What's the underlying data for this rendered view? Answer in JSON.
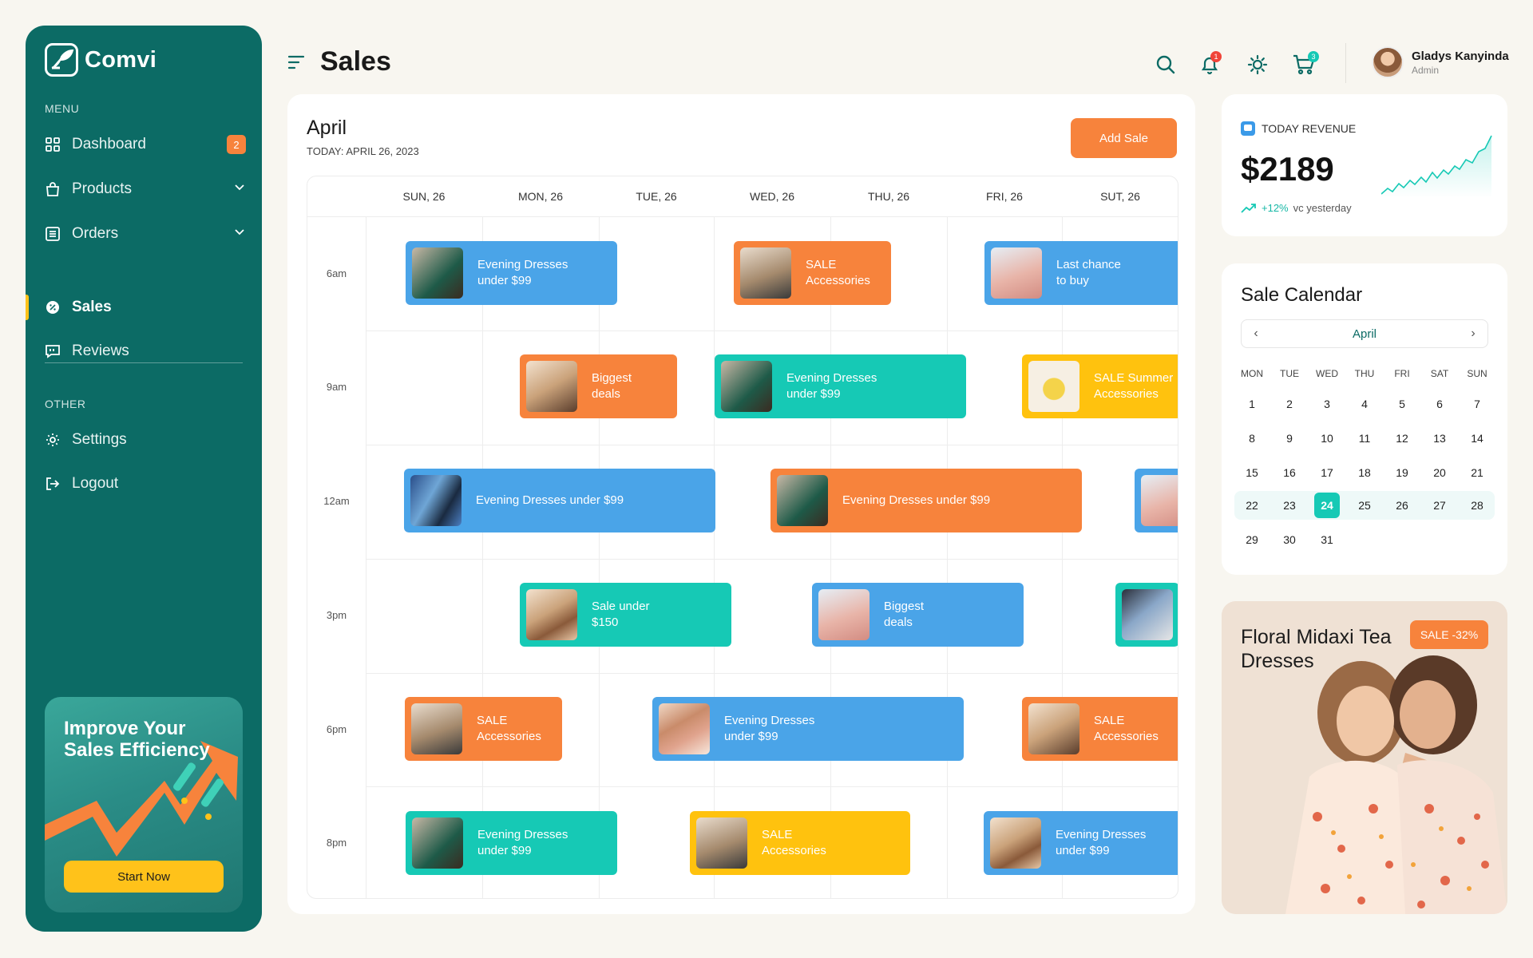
{
  "brand": {
    "name": "Comvi"
  },
  "sidebar": {
    "menu_heading": "MENU",
    "items": [
      {
        "label": "Dashboard",
        "icon": "grid-icon",
        "badge": "2"
      },
      {
        "label": "Products",
        "icon": "bag-icon"
      },
      {
        "label": "Orders",
        "icon": "list-icon"
      },
      {
        "label": "Sales",
        "icon": "badge-percent-icon",
        "active": true
      },
      {
        "label": "Reviews",
        "icon": "chat-icon"
      }
    ],
    "other_heading": "OTHER",
    "other_items": [
      {
        "label": "Settings",
        "icon": "gear-icon"
      },
      {
        "label": "Logout",
        "icon": "logout-icon"
      }
    ],
    "promo": {
      "title": "Improve Your Sales Efficiency",
      "button": "Start Now"
    }
  },
  "header": {
    "title": "Sales",
    "notifications": "1",
    "cart_count": "3",
    "user": {
      "name": "Gladys Kanyinda",
      "role": "Admin"
    }
  },
  "schedule": {
    "month": "April",
    "today": "TODAY: APRIL 26, 2023",
    "add_button": "Add Sale",
    "days": [
      "SUN, 26",
      "MON, 26",
      "TUE, 26",
      "WED, 26",
      "THU, 26",
      "FRI, 26",
      "SUT, 26"
    ],
    "times": [
      "6am",
      "9am",
      "12am",
      "3pm",
      "6pm",
      "8pm"
    ],
    "events": [
      {
        "text": "Evening Dresses\nunder $99",
        "color": "blue"
      },
      {
        "text": "SALE\nAccessories",
        "color": "orange"
      },
      {
        "text": "Last chance\nto buy",
        "color": "blue"
      },
      {
        "text": "Biggest\ndeals",
        "color": "orange"
      },
      {
        "text": "Evening Dresses\nunder $99",
        "color": "teal"
      },
      {
        "text": "SALE Summer\nAccessories",
        "color": "yellow"
      },
      {
        "text": "Evening Dresses under $99",
        "color": "blue"
      },
      {
        "text": "Evening Dresses under $99",
        "color": "orange"
      },
      {
        "text": "",
        "color": "blue"
      },
      {
        "text": "Sale under\n$150",
        "color": "teal"
      },
      {
        "text": "Biggest\ndeals",
        "color": "blue"
      },
      {
        "text": "",
        "color": "teal"
      },
      {
        "text": "SALE\nAccessories",
        "color": "orange"
      },
      {
        "text": "Evening Dresses\nunder $99",
        "color": "blue"
      },
      {
        "text": "SALE\nAccessories",
        "color": "orange"
      },
      {
        "text": "Evening Dresses\nunder $99",
        "color": "teal"
      },
      {
        "text": "SALE\nAccessories",
        "color": "yellow"
      },
      {
        "text": "Evening Dresses\nunder $99",
        "color": "blue"
      }
    ]
  },
  "revenue": {
    "label": "TODAY REVENUE",
    "value": "$2189",
    "change": "+12%",
    "change_note": "vc yesterday"
  },
  "calendar": {
    "title": "Sale Calendar",
    "month": "April",
    "weekdays": [
      "MON",
      "TUE",
      "WED",
      "THU",
      "FRI",
      "SAT",
      "SUN"
    ],
    "days": [
      "1",
      "2",
      "3",
      "4",
      "5",
      "6",
      "7",
      "8",
      "9",
      "10",
      "11",
      "12",
      "13",
      "14",
      "15",
      "16",
      "17",
      "18",
      "19",
      "20",
      "21",
      "22",
      "23",
      "24",
      "25",
      "26",
      "27",
      "28",
      "29",
      "30",
      "31"
    ],
    "selected": "24"
  },
  "promo_card": {
    "title": "Floral Midaxi Tea Dresses",
    "tag": "SALE -32%"
  },
  "colors": {
    "primary": "#0c6b65",
    "accent": "#f7833c",
    "teal": "#16c9b5",
    "blue": "#4aa4e8",
    "yellow": "#ffc20e"
  }
}
